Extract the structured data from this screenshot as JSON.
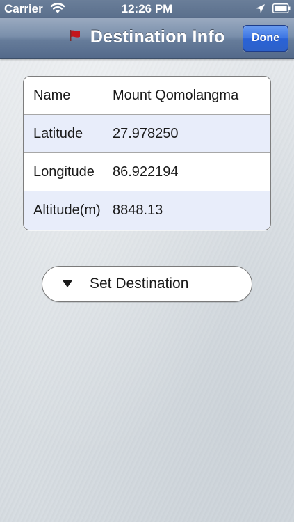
{
  "status_bar": {
    "carrier": "Carrier",
    "time": "12:26 PM",
    "icons": [
      "wifi-icon",
      "location-icon",
      "battery-icon"
    ]
  },
  "nav_bar": {
    "title": "Destination Info",
    "title_icon": "flag-icon",
    "done_label": "Done"
  },
  "info": {
    "rows": [
      {
        "label": "Name",
        "value": "Mount Qomolangma"
      },
      {
        "label": "Latitude",
        "value": "27.978250"
      },
      {
        "label": "Longitude",
        "value": "86.922194"
      },
      {
        "label": "Altitude(m)",
        "value": "8848.13"
      }
    ]
  },
  "set_destination": {
    "label": "Set Destination",
    "icon": "triangle-down-icon"
  },
  "colors": {
    "nav_bar": "#667c9a",
    "done_button": "#3e76e3",
    "row_alt": "#e8edfa",
    "flag": "#c4161c"
  }
}
